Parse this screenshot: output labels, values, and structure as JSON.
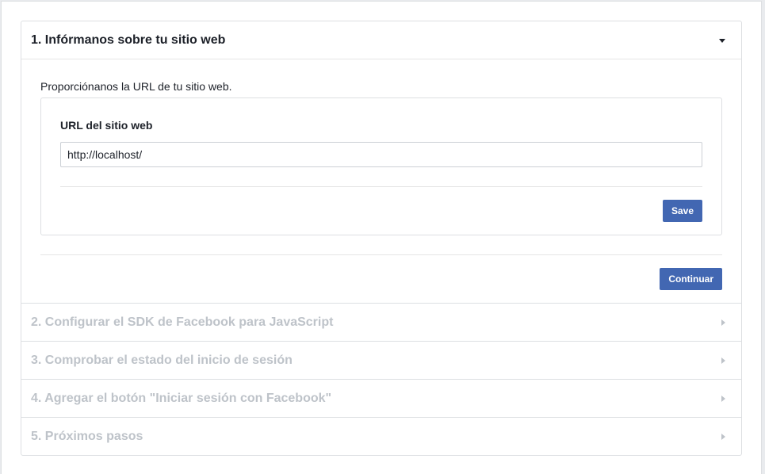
{
  "steps": [
    {
      "title": "1. Infórmanos sobre tu sitio web",
      "expanded": true,
      "intro": "Proporciónanos la URL de tu sitio web.",
      "field_label": "URL del sitio web",
      "url_value": "http://localhost/",
      "save_label": "Save",
      "continue_label": "Continuar"
    },
    {
      "title": "2. Configurar el SDK de Facebook para JavaScript",
      "expanded": false
    },
    {
      "title": "3. Comprobar el estado del inicio de sesión",
      "expanded": false
    },
    {
      "title": "4. Agregar el botón \"Iniciar sesión con Facebook\"",
      "expanded": false
    },
    {
      "title": "5. Próximos pasos",
      "expanded": false
    }
  ],
  "colors": {
    "primary_button": "#4267b2",
    "active_title": "#1d2129",
    "inactive_title": "#bec3c9",
    "border": "#dddfe2"
  },
  "icons": {
    "expanded": "caret-down-icon",
    "collapsed": "caret-right-icon"
  }
}
